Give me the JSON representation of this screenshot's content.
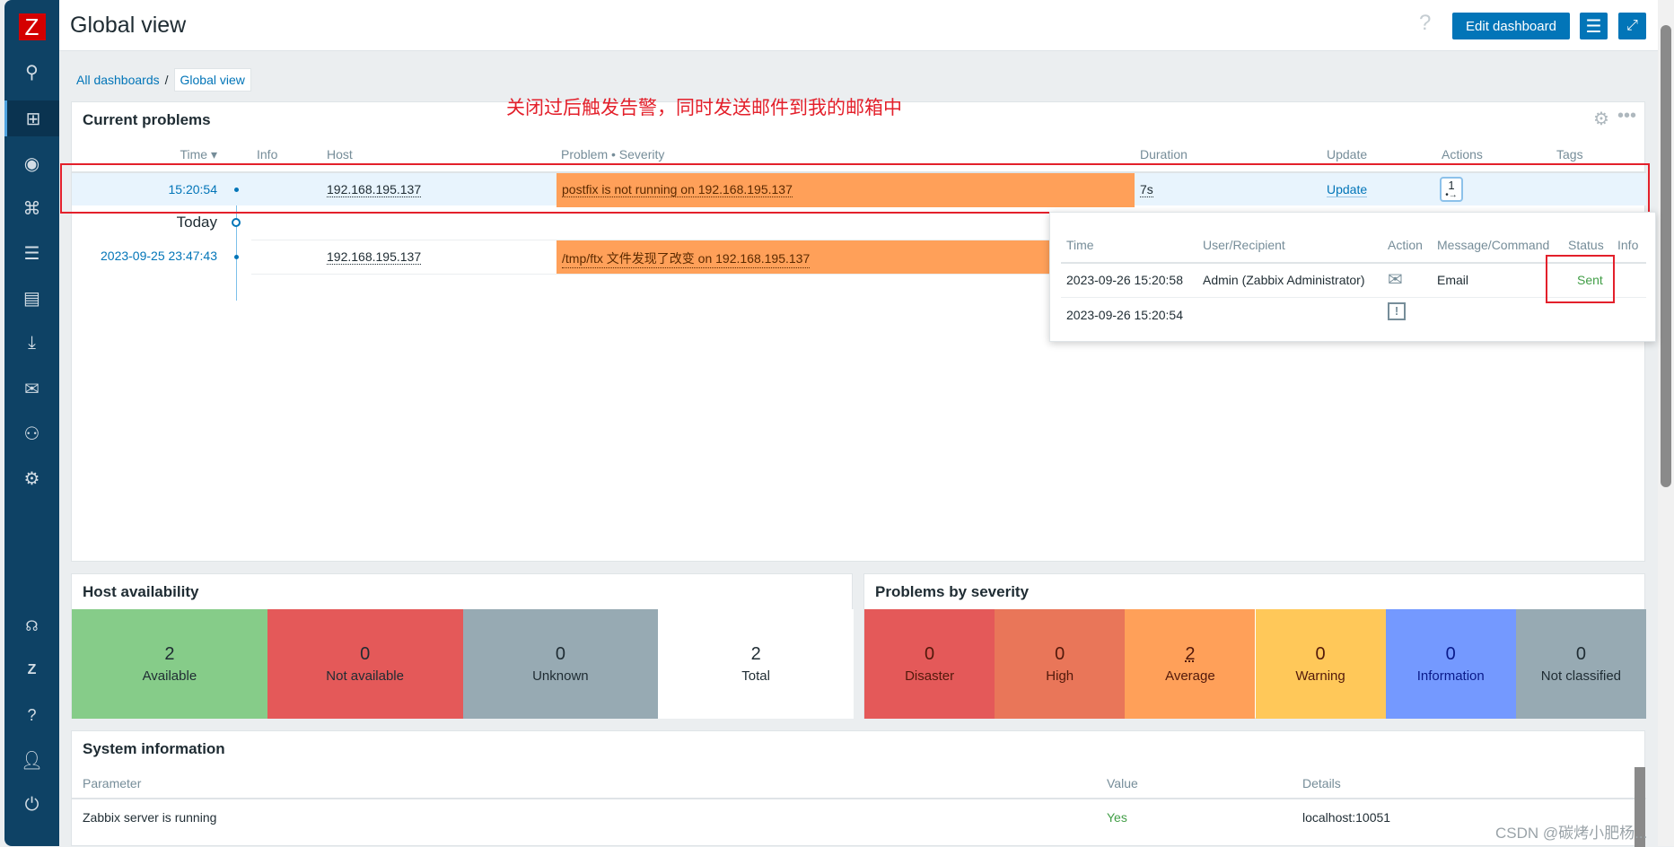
{
  "sidebar": {
    "items": [
      {
        "icon": "search-icon"
      },
      {
        "icon": "dashboard-icon",
        "active": true
      },
      {
        "icon": "eye-icon"
      },
      {
        "icon": "network-icon"
      },
      {
        "icon": "list-icon"
      },
      {
        "icon": "report-icon"
      },
      {
        "icon": "download-icon"
      },
      {
        "icon": "mail-icon"
      },
      {
        "icon": "users-icon"
      },
      {
        "icon": "gear-icon"
      },
      {
        "icon": "headset-icon"
      },
      {
        "icon": "zabbix-icon"
      },
      {
        "icon": "help-icon"
      },
      {
        "icon": "user-icon"
      },
      {
        "icon": "power-icon"
      }
    ],
    "logo": "Z"
  },
  "header": {
    "title": "Global view",
    "help": "?",
    "edit_label": "Edit dashboard"
  },
  "breadcrumb": {
    "parent": "All dashboards",
    "sep": "/",
    "current": "Global view"
  },
  "annotation": "关闭过后触发告警，同时发送邮件到我的邮箱中",
  "problems": {
    "title": "Current problems",
    "columns": {
      "time": "Time ▾",
      "info": "Info",
      "host": "Host",
      "problem": "Problem • Severity",
      "duration": "Duration",
      "update": "Update",
      "actions": "Actions",
      "tags": "Tags"
    },
    "rows": [
      {
        "time": "15:20:54",
        "host": "192.168.195.137",
        "problem": "postfix is not running on 192.168.195.137",
        "duration": "7s",
        "update": "Update",
        "actions": "1"
      },
      {
        "time": "2023-09-25 23:47:43",
        "host": "192.168.195.137",
        "problem": "/tmp/ftx 文件发现了改变 on 192.168.195.137"
      }
    ],
    "today": "Today",
    "severity_color": "#ffa059"
  },
  "popup": {
    "columns": {
      "time": "Time",
      "user": "User/Recipient",
      "action": "Action",
      "message": "Message/Command",
      "status": "Status",
      "info": "Info"
    },
    "rows": [
      {
        "time": "2023-09-26 15:20:58",
        "user": "Admin (Zabbix Administrator)",
        "action_icon": "mail-icon",
        "message": "Email",
        "status": "Sent"
      },
      {
        "time": "2023-09-26 15:20:54",
        "action_icon": "problem-calendar-icon"
      }
    ]
  },
  "host_availability": {
    "title": "Host availability",
    "tiles": [
      {
        "count": "2",
        "label": "Available",
        "color": "#86cc89"
      },
      {
        "count": "0",
        "label": "Not available",
        "color": "#e45959"
      },
      {
        "count": "0",
        "label": "Unknown",
        "color": "#97aab3"
      },
      {
        "count": "2",
        "label": "Total",
        "color": "#ffffff"
      }
    ]
  },
  "severity": {
    "title": "Problems by severity",
    "tiles": [
      {
        "count": "0",
        "label": "Disaster",
        "color": "#e45959"
      },
      {
        "count": "0",
        "label": "High",
        "color": "#e97659"
      },
      {
        "count": "2",
        "label": "Average",
        "color": "#ffa059"
      },
      {
        "count": "0",
        "label": "Warning",
        "color": "#ffc859"
      },
      {
        "count": "0",
        "label": "Information",
        "color": "#7499ff"
      },
      {
        "count": "0",
        "label": "Not classified",
        "color": "#97aab3"
      }
    ]
  },
  "sysinfo": {
    "title": "System information",
    "columns": {
      "param": "Parameter",
      "value": "Value",
      "details": "Details"
    },
    "rows": [
      {
        "param": "Zabbix server is running",
        "value": "Yes",
        "details": "localhost:10051"
      }
    ]
  },
  "watermark": "CSDN @碳烤小肥杨..."
}
